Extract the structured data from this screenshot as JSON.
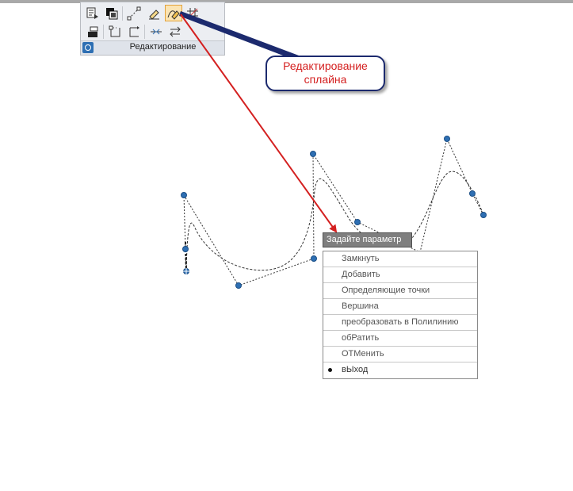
{
  "ribbon": {
    "panel_title": "Редактирование",
    "row1_tools": [
      {
        "icon": "properties-match-icon"
      },
      {
        "icon": "draw-order-icon"
      },
      {
        "icon": "line-stretch-icon"
      },
      {
        "icon": "erase-pencil-icon"
      },
      {
        "icon": "edit-spline-icon"
      },
      {
        "icon": "trim-grid-icon"
      }
    ],
    "row2_tools": [
      {
        "icon": "layer-block-icon"
      },
      {
        "icon": "break-icon"
      },
      {
        "icon": "extend-icon"
      },
      {
        "icon": "join-icon"
      },
      {
        "icon": "reverse-icon"
      }
    ]
  },
  "callout": {
    "line1": "Редактирование",
    "line2": "сплайна"
  },
  "context_menu": {
    "title": "Задайте параметр",
    "items": [
      {
        "label": "Замкнуть"
      },
      {
        "label": "Добавить"
      },
      {
        "label": "Определяющие точки"
      },
      {
        "label": "Вершина"
      },
      {
        "label": "преобразовать в Полилинию"
      },
      {
        "label": "обРатить"
      },
      {
        "label": "ОТМенить"
      },
      {
        "label": "вЫход",
        "selected": true
      }
    ]
  },
  "colors": {
    "callout_text": "#d42020",
    "callout_border": "#1c2a6e",
    "arrow_red": "#d42020",
    "arrow_navy": "#1c2a6e",
    "grip_blue": "#2e6fb3"
  }
}
